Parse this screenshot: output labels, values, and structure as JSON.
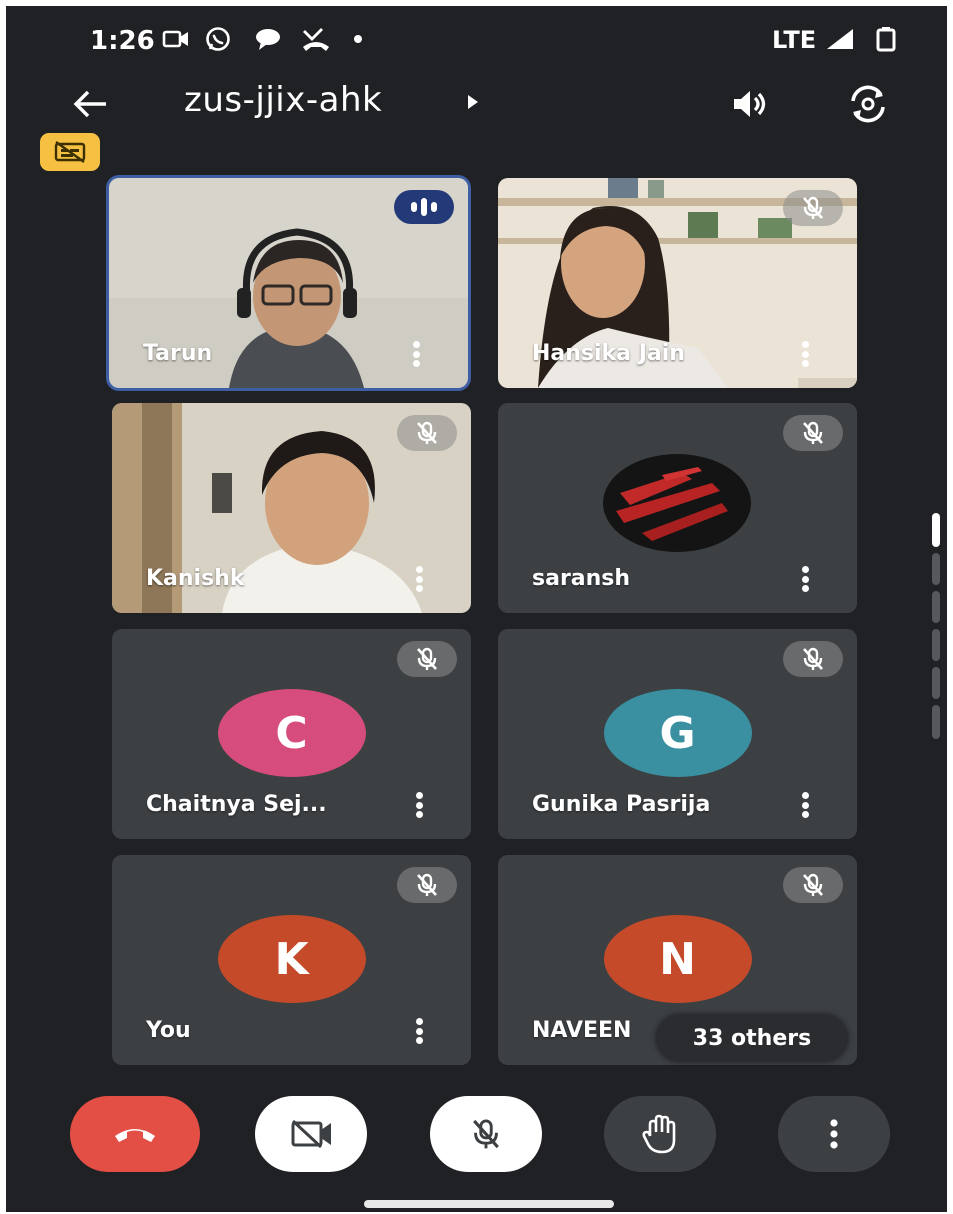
{
  "status_bar": {
    "time": "1:26",
    "network": "LTE",
    "icons": [
      "video-call-icon",
      "whatsapp-icon",
      "chat-bubble-icon",
      "missed-call-icon",
      "notification-dot-icon",
      "signal-icon",
      "battery-icon"
    ]
  },
  "header": {
    "meeting_code": "zus-jjix-ahk",
    "icons": [
      "back-arrow-icon",
      "speaker-icon",
      "switch-camera-icon"
    ]
  },
  "participants": [
    {
      "name": "Tarun",
      "kind": "video",
      "speaking": true
    },
    {
      "name": "Hansika Jain",
      "kind": "video",
      "muted": true
    },
    {
      "name": "Kanishk",
      "kind": "video",
      "muted": true
    },
    {
      "name": "saransh",
      "kind": "avatar-image",
      "muted": true
    },
    {
      "name": "Chaitnya Sej...",
      "kind": "initial",
      "initial": "C",
      "color": "#d64d7d",
      "muted": true
    },
    {
      "name": "Gunika Pasrija",
      "kind": "initial",
      "initial": "G",
      "color": "#3a8fa0",
      "muted": true
    },
    {
      "name": "You",
      "kind": "initial",
      "initial": "K",
      "color": "#c44a2a",
      "muted": true
    },
    {
      "name": "NAVEEN",
      "kind": "initial",
      "initial": "N",
      "color": "#c44a2a",
      "muted": true
    }
  ],
  "others_chip": "33 others",
  "controls": {
    "end_call_color": "#e34e45",
    "items": [
      "end-call",
      "camera-off",
      "mic-off",
      "raise-hand",
      "more-options"
    ]
  }
}
